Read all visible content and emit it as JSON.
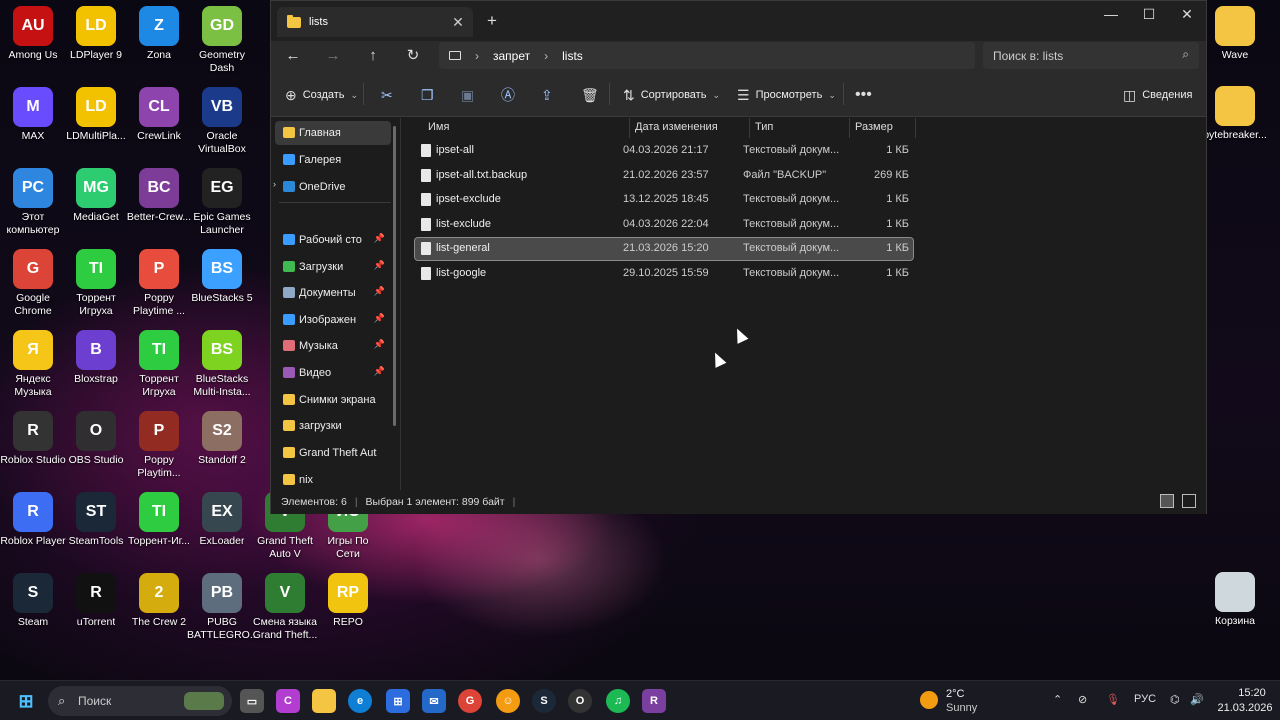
{
  "desktop_icons": [
    {
      "label": "Among Us",
      "color": "#c51111",
      "glyph": "AU"
    },
    {
      "label": "LDPlayer 9",
      "color": "#f2c200",
      "glyph": "LD"
    },
    {
      "label": "Zona",
      "color": "#1e88e5",
      "glyph": "Z"
    },
    {
      "label": "Geometry Dash",
      "color": "#7bc043",
      "glyph": "GD"
    },
    {
      "label": "MAX",
      "color": "#6a4cff",
      "glyph": "M"
    },
    {
      "label": "LDMultiPla...",
      "color": "#f2c200",
      "glyph": "LD"
    },
    {
      "label": "CrewLink",
      "color": "#8e44ad",
      "glyph": "CL"
    },
    {
      "label": "Oracle VirtualBox",
      "color": "#1b3a8a",
      "glyph": "VB"
    },
    {
      "label": "Этот компьютер",
      "color": "#2e86de",
      "glyph": "PC"
    },
    {
      "label": "MediaGet",
      "color": "#2ecc71",
      "glyph": "MG"
    },
    {
      "label": "Better-Crew...",
      "color": "#7d3c98",
      "glyph": "BC"
    },
    {
      "label": "Epic Games Launcher",
      "color": "#222222",
      "glyph": "EG"
    },
    {
      "label": "Google Chrome",
      "color": "#db4437",
      "glyph": "G"
    },
    {
      "label": "Торрент Игруха",
      "color": "#2ecc40",
      "glyph": "TI"
    },
    {
      "label": "Poppy Playtime ...",
      "color": "#e74c3c",
      "glyph": "P"
    },
    {
      "label": "BlueStacks 5",
      "color": "#3ba0ff",
      "glyph": "BS"
    },
    {
      "label": "Яндекс Музыка",
      "color": "#f5c518",
      "glyph": "Я"
    },
    {
      "label": "Bloxstrap",
      "color": "#6c3fd1",
      "glyph": "B"
    },
    {
      "label": "Торрент Игруха",
      "color": "#2ecc40",
      "glyph": "TI"
    },
    {
      "label": "BlueStacks Multi-Insta...",
      "color": "#7ed321",
      "glyph": "BS"
    },
    {
      "label": "Roblox Studio",
      "color": "#333333",
      "glyph": "R"
    },
    {
      "label": "OBS Studio",
      "color": "#302e31",
      "glyph": "O"
    },
    {
      "label": "Poppy Playtim...",
      "color": "#922b21",
      "glyph": "P"
    },
    {
      "label": "Standoff 2",
      "color": "#8d6e63",
      "glyph": "S2"
    },
    {
      "label": "Roblox Player",
      "color": "#3d6df2",
      "glyph": "R"
    },
    {
      "label": "SteamTools",
      "color": "#1b2838",
      "glyph": "ST"
    },
    {
      "label": "Торрент-Иг...",
      "color": "#2ecc40",
      "glyph": "TI"
    },
    {
      "label": "ExLoader",
      "color": "#37474f",
      "glyph": "EX"
    },
    {
      "label": "Grand Theft Auto V",
      "color": "#2e7d32",
      "glyph": "V"
    },
    {
      "label": "Игры По Сети",
      "color": "#43a047",
      "glyph": "ИС"
    },
    {
      "label": "Steam",
      "color": "#1b2838",
      "glyph": "S"
    },
    {
      "label": "uTorrent",
      "color": "#111111",
      "glyph": "R"
    },
    {
      "label": "The Crew 2",
      "color": "#d4ac0d",
      "glyph": "2"
    },
    {
      "label": "PUBG BATTLEGRO...",
      "color": "#5d6d7e",
      "glyph": "PB"
    },
    {
      "label": "Смена языка Grand Theft...",
      "color": "#2e7d32",
      "glyph": "V"
    },
    {
      "label": "REPO",
      "color": "#f1c40f",
      "glyph": "RP"
    }
  ],
  "right_icons": [
    {
      "label": "Wave",
      "color": "#f4c542"
    },
    {
      "label": "bytebreaker...",
      "color": "#f4c542"
    },
    {
      "label": "Корзина",
      "color": "#cfd8dc"
    }
  ],
  "window": {
    "tab_title": "lists",
    "path": [
      "запрет",
      "lists"
    ],
    "search_placeholder": "Поиск в: lists",
    "toolbar": {
      "create": "Создать",
      "sort": "Сортировать",
      "view": "Просмотреть",
      "details": "Сведения"
    },
    "nav_items": [
      {
        "label": "Главная",
        "color": "#f4c542",
        "active": true,
        "pin": false
      },
      {
        "label": "Галерея",
        "color": "#3b9cff",
        "active": false,
        "pin": false
      },
      {
        "label": "OneDrive",
        "color": "#2b88d8",
        "active": false,
        "pin": false
      },
      {
        "label": "Рабочий сто",
        "color": "#3b9cff",
        "active": false,
        "pin": true
      },
      {
        "label": "Загрузки",
        "color": "#3fb950",
        "active": false,
        "pin": true
      },
      {
        "label": "Документы",
        "color": "#8fa8c8",
        "active": false,
        "pin": true
      },
      {
        "label": "Изображен",
        "color": "#3b9cff",
        "active": false,
        "pin": true
      },
      {
        "label": "Музыка",
        "color": "#e06c75",
        "active": false,
        "pin": true
      },
      {
        "label": "Видео",
        "color": "#9b59b6",
        "active": false,
        "pin": true
      },
      {
        "label": "Снимки экрана",
        "color": "#f4c542",
        "active": false,
        "pin": false
      },
      {
        "label": "загрузки",
        "color": "#f4c542",
        "active": false,
        "pin": false
      },
      {
        "label": "Grand Theft Aut",
        "color": "#f4c542",
        "active": false,
        "pin": false
      },
      {
        "label": "nix",
        "color": "#f4c542",
        "active": false,
        "pin": false
      }
    ],
    "columns": [
      "Имя",
      "Дата изменения",
      "Тип",
      "Размер"
    ],
    "files": [
      {
        "name": "ipset-all",
        "date": "04.03.2026 21:17",
        "type": "Текстовый докум...",
        "size": "1 КБ",
        "selected": false
      },
      {
        "name": "ipset-all.txt.backup",
        "date": "21.02.2026 23:57",
        "type": "Файл \"BACKUP\"",
        "size": "269 КБ",
        "selected": false
      },
      {
        "name": "ipset-exclude",
        "date": "13.12.2025 18:45",
        "type": "Текстовый докум...",
        "size": "1 КБ",
        "selected": false
      },
      {
        "name": "list-exclude",
        "date": "04.03.2026 22:04",
        "type": "Текстовый докум...",
        "size": "1 КБ",
        "selected": false
      },
      {
        "name": "list-general",
        "date": "21.03.2026 15:20",
        "type": "Текстовый докум...",
        "size": "1 КБ",
        "selected": true
      },
      {
        "name": "list-google",
        "date": "29.10.2025 15:59",
        "type": "Текстовый докум...",
        "size": "1 КБ",
        "selected": false
      }
    ],
    "status": {
      "count": "Элементов: 6",
      "selection": "Выбран 1 элемент: 899 байт"
    }
  },
  "taskbar": {
    "search_placeholder": "Поиск",
    "weather_temp": "2°C",
    "weather_desc": "Sunny",
    "language": "РУС",
    "time": "15:20",
    "date": "21.03.2026"
  }
}
